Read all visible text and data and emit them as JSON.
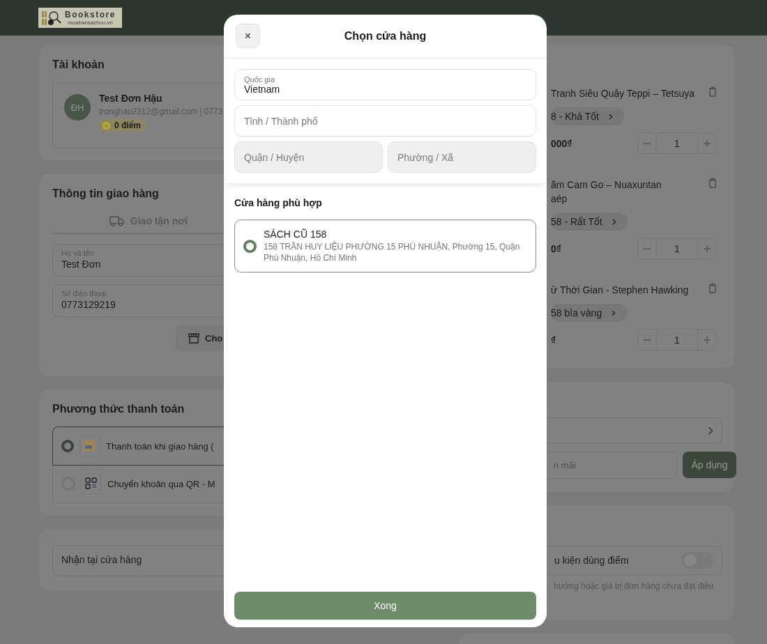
{
  "header": {
    "logo": {
      "title": "Bookstore",
      "subtitle": "muabansachcu.vn"
    }
  },
  "account": {
    "title": "Tài khoản",
    "avatar": "ĐH",
    "name": "Test Đơn Hậu",
    "contact": "tronghau2312@gmail.com | 0773",
    "points": "0 điểm"
  },
  "shipping": {
    "title": "Thông tin giao hàng",
    "tabs": [
      {
        "label": "Giao tận nơi",
        "selected": false
      }
    ],
    "fields": [
      {
        "label": "Họ và tên",
        "value": "Test Đơn"
      },
      {
        "label": "Số điện thoại",
        "value": "0773129219"
      }
    ],
    "store_button": "Cho"
  },
  "payment": {
    "title": "Phương thức thanh toán",
    "options": [
      {
        "kind": "cod",
        "label": "Thanh toán khi giao hàng (",
        "selected": true
      },
      {
        "kind": "qr",
        "label": "Chuyển khoản qua QR - M",
        "selected": false
      }
    ]
  },
  "pickup": {
    "value": "Nhận tại cửa hàng"
  },
  "cart": {
    "items": [
      {
        "title": "Tranh Siêu Quậy Teppi – Tetsuya",
        "variant": "8 - Khá Tốt",
        "price": "000₫",
        "quantity": "1"
      },
      {
        "title": "ăm Cam Go – Nuaxuntan\naép",
        "variant": "58 - Rất Tốt",
        "price": "0₫",
        "quantity": "1"
      },
      {
        "title": "ử Thời Gian - Stephen Hawking",
        "variant": "58 bìa vàng",
        "price": "₫",
        "quantity": "1"
      }
    ]
  },
  "promo": {
    "placeholder": "n mãi",
    "apply_button": "Áp dụng"
  },
  "points": {
    "label": "u kiện dùng điểm",
    "on": false,
    "note": "hưởng hoặc giá trị đơn hàng chưa đạt điều"
  },
  "modal": {
    "close": "×",
    "title": "Chọn cửa hàng",
    "fields": [
      {
        "label": "Quốc gia",
        "value": "Vietnam",
        "disabled": false
      },
      {
        "placeholder": "Tỉnh / Thành phố",
        "disabled": false
      },
      {
        "placeholder": "Quận / Huyện",
        "disabled": true
      },
      {
        "placeholder": "Phường / Xã",
        "disabled": true
      }
    ],
    "stores_title": "Cửa hàng phù hợp",
    "stores": [
      {
        "name": "SÁCH CŨ 158",
        "address": "158 TRẦN HUY LIỆU PHƯỜNG 15 PHÚ NHUẬN, Phường 15, Quận Phú Nhuận, Hồ Chí Minh",
        "selected": true
      }
    ],
    "done_button": "Xong"
  }
}
